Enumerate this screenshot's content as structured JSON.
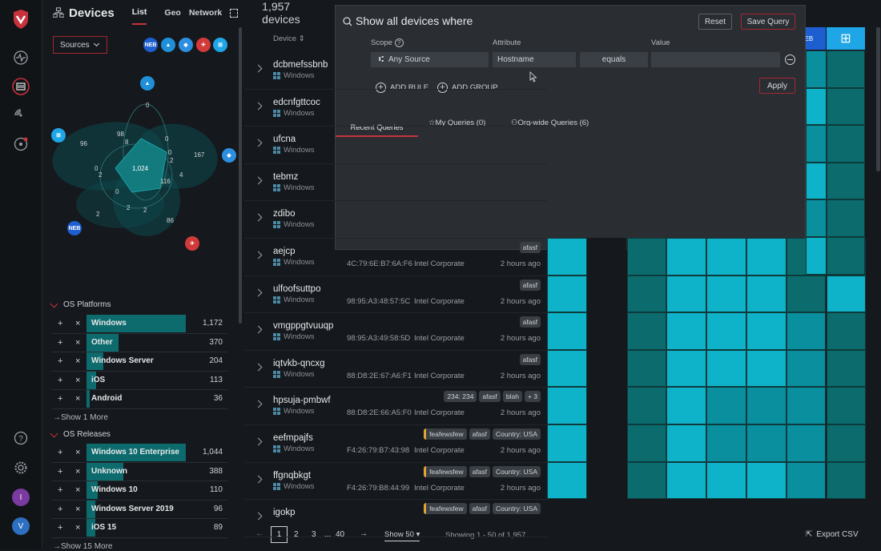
{
  "app": {
    "title": "Devices",
    "tabs": [
      "List",
      "Geo",
      "Network"
    ],
    "device_count": "1,957 devices"
  },
  "sources": {
    "label": "Sources"
  },
  "venn": {
    "values": [
      "0",
      "98",
      "8",
      "96",
      "1,024",
      "167",
      "2",
      "4",
      "2",
      "116",
      "0",
      "0",
      "0",
      "2",
      "2",
      "2",
      "86",
      "0"
    ]
  },
  "os_platforms": {
    "title": "OS Platforms",
    "items": [
      {
        "name": "Windows",
        "count": "1,172",
        "frac": 1.0
      },
      {
        "name": "Other",
        "count": "370",
        "frac": 0.32
      },
      {
        "name": "Windows Server",
        "count": "204",
        "frac": 0.17
      },
      {
        "name": "iOS",
        "count": "113",
        "frac": 0.1
      },
      {
        "name": "Android",
        "count": "36",
        "frac": 0.03
      }
    ],
    "more": "Show 1 More"
  },
  "os_releases": {
    "title": "OS Releases",
    "items": [
      {
        "name": "Windows 10 Enterprise",
        "count": "1,044",
        "frac": 1.0
      },
      {
        "name": "Unknown",
        "count": "388",
        "frac": 0.37
      },
      {
        "name": "Windows 10",
        "count": "110",
        "frac": 0.11
      },
      {
        "name": "Windows Server 2019",
        "count": "96",
        "frac": 0.09
      },
      {
        "name": "iOS 15",
        "count": "89",
        "frac": 0.09
      }
    ],
    "more": "Show 15 More"
  },
  "table": {
    "col_device": "Device"
  },
  "devices": [
    {
      "name": "dcbmefssbnb",
      "os": "Windows",
      "mac": "",
      "vendor": "",
      "ago": "",
      "tags": []
    },
    {
      "name": "edcnfgttcoc",
      "os": "Windows",
      "mac": "",
      "vendor": "",
      "ago": "",
      "tags": []
    },
    {
      "name": "ufcna",
      "os": "Windows",
      "mac": "",
      "vendor": "",
      "ago": "",
      "tags": []
    },
    {
      "name": "tebmz",
      "os": "Windows",
      "mac": "",
      "vendor": "",
      "ago": "",
      "tags": []
    },
    {
      "name": "zdibo",
      "os": "Windows",
      "mac": "",
      "vendor": "",
      "ago": "",
      "tags": []
    },
    {
      "name": "aejcp",
      "os": "Windows",
      "mac": "4C:79:6E:B7:6A:F6",
      "vendor": "Intel Corporate",
      "ago": "2 hours ago",
      "tags": [
        {
          "t": "afasf"
        }
      ]
    },
    {
      "name": "ulfoofsuttpo",
      "os": "Windows",
      "mac": "98:95:A3:48:57:5C",
      "vendor": "Intel Corporate",
      "ago": "2 hours ago",
      "tags": [
        {
          "t": "afasf"
        }
      ]
    },
    {
      "name": "vmgppgtvuuqp",
      "os": "Windows",
      "mac": "98:95:A3:49:58:5D",
      "vendor": "Intel Corporate",
      "ago": "2 hours ago",
      "tags": [
        {
          "t": "afasf"
        }
      ]
    },
    {
      "name": "iqtvkb-qncxg",
      "os": "Windows",
      "mac": "88:D8:2E:67:A6:F1",
      "vendor": "Intel Corporate",
      "ago": "2 hours ago",
      "tags": [
        {
          "t": "afasf"
        }
      ]
    },
    {
      "name": "hpsuja-pmbwf",
      "os": "Windows",
      "mac": "88:D8:2E:66:A5:F0",
      "vendor": "Intel Corporate",
      "ago": "2 hours ago",
      "tags": [
        {
          "t": "234: 234"
        },
        {
          "t": "afasf"
        },
        {
          "t": "blah"
        },
        {
          "t": "+ 3"
        }
      ]
    },
    {
      "name": "eefmpajfs",
      "os": "Windows",
      "mac": "F4:26:79:B7:43:98",
      "vendor": "Intel Corporate",
      "ago": "2 hours ago",
      "tags": [
        {
          "t": "feafewsfew",
          "y": true
        },
        {
          "t": "afasf"
        },
        {
          "t": "Country: USA"
        }
      ]
    },
    {
      "name": "ffgnqbkgt",
      "os": "Windows",
      "mac": "F4:26:79:B8:44:99",
      "vendor": "Intel Corporate",
      "ago": "2 hours ago",
      "tags": [
        {
          "t": "feafewsfew",
          "y": true
        },
        {
          "t": "afasf"
        },
        {
          "t": "Country: USA"
        }
      ]
    },
    {
      "name": "igokp",
      "os": "",
      "mac": "",
      "vendor": "",
      "ago": "",
      "tags": [
        {
          "t": "feafewsfew",
          "y": true
        },
        {
          "t": "afasf"
        },
        {
          "t": "Country: USA"
        }
      ]
    }
  ],
  "query": {
    "title": "Show all devices where",
    "reset": "Reset",
    "save": "Save Query",
    "scope_label": "Scope",
    "attr_label": "Attribute",
    "value_label": "Value",
    "scope": "Any Source",
    "attribute": "Hostname",
    "operator": "equals",
    "value": "",
    "add_rule": "ADD RULE",
    "add_group": "ADD GROUP",
    "apply": "Apply",
    "tabs": [
      "Recent Queries",
      "My Queries (0)",
      "Org-wide Queries (6)"
    ]
  },
  "pagination": {
    "pages": [
      "1",
      "2",
      "3",
      "...",
      "40"
    ],
    "show": "Show 50",
    "summary": "Showing 1 - 50 of 1,957",
    "export": "Export CSV"
  },
  "colors": {
    "accent": "#c8323c",
    "teal_light": "#0fb3c9",
    "teal_mid": "#0a8f9e",
    "teal_dark": "#0b6b6d"
  }
}
